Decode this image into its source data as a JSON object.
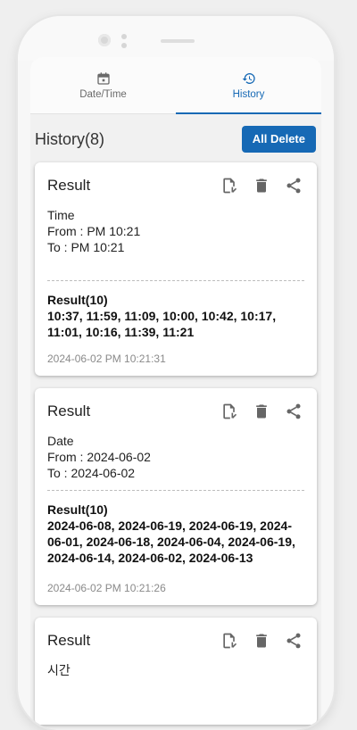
{
  "tabs": [
    {
      "label": "Date/Time",
      "icon": "calendar-icon",
      "active": false
    },
    {
      "label": "History",
      "icon": "history-icon",
      "active": true
    }
  ],
  "header": {
    "title": "History(8)",
    "all_delete_label": "All Delete"
  },
  "colors": {
    "accent": "#1669b5",
    "icon": "#666666"
  },
  "cards": [
    {
      "title": "Result",
      "kind": "Time",
      "from": "From : PM 10:21",
      "to": "To : PM 10:21",
      "result_label": "Result(10)",
      "result_values": "10:37, 11:59, 11:09, 10:00, 10:42, 10:17, 11:01, 10:16, 11:39, 11:21",
      "timestamp": "2024-06-02 PM 10:21:31"
    },
    {
      "title": "Result",
      "kind": "Date",
      "from": "From : 2024-06-02",
      "to": "To : 2024-06-02",
      "result_label": "Result(10)",
      "result_values": "2024-06-08, 2024-06-19, 2024-06-19, 2024-06-01, 2024-06-18, 2024-06-04, 2024-06-19, 2024-06-14, 2024-06-02, 2024-06-13",
      "timestamp": "2024-06-02 PM 10:21:26"
    },
    {
      "title": "Result",
      "kind": "시간"
    }
  ]
}
